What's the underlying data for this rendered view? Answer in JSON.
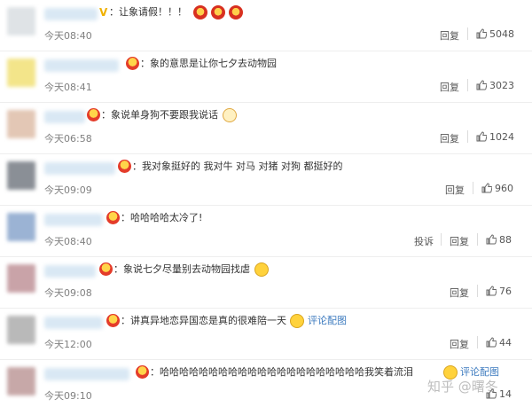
{
  "comments": [
    {
      "avatar_color": "#dfe3e6",
      "text": "：让象请假！！！",
      "time": "今天08:40",
      "reply": "回复",
      "likes": "5048",
      "has_v": true,
      "emoji": [
        "red-face-icon",
        "red-face-icon",
        "red-face-icon"
      ]
    },
    {
      "avatar_color": "#f3e58a",
      "text": "：象的意思是让你七夕去动物园",
      "time": "今天08:41",
      "reply": "回复",
      "likes": "3023"
    },
    {
      "avatar_color": "#e3c7b5",
      "text": "：象说单身狗不要跟我说话",
      "time": "今天06:58",
      "reply": "回复",
      "likes": "1024",
      "emoji": [
        "cat-face-icon"
      ]
    },
    {
      "avatar_color": "#8a8f96",
      "text": "：我对象挺好的 我对牛 对马 对猪 对狗 都挺好的",
      "time": "今天09:09",
      "reply": "回复",
      "likes": "960"
    },
    {
      "avatar_color": "#9bb3d4",
      "text": "：哈哈哈哈太冷了!",
      "time": "今天08:40",
      "report": "投诉",
      "reply": "回复",
      "likes": "88"
    },
    {
      "avatar_color": "#c9a3a8",
      "text": "：象说七夕尽量别去动物园找虐",
      "time": "今天09:08",
      "reply": "回复",
      "likes": "76",
      "emoji": [
        "tongue-face-icon"
      ]
    },
    {
      "avatar_color": "#b9b9b9",
      "text": "：讲真异地恋异国恋是真的很难陪一天",
      "time": "今天12:00",
      "reply": "回复",
      "likes": "44",
      "emoji": [
        "crying-face-icon"
      ],
      "link": "评论配图"
    },
    {
      "avatar_color": "#c7a8a8",
      "text": "：哈哈哈哈哈哈哈哈哈哈哈哈哈哈哈哈哈哈哈哈哈我笑着流泪",
      "time": "今天09:10",
      "reply": "回复",
      "likes": "14",
      "emoji": [
        "crying-face-icon"
      ],
      "link": "评论配图"
    }
  ],
  "watermark": "知乎 @曙冬",
  "colors": {
    "link": "#3d7bbf",
    "muted": "#808080",
    "crown": "#e43c2a"
  }
}
